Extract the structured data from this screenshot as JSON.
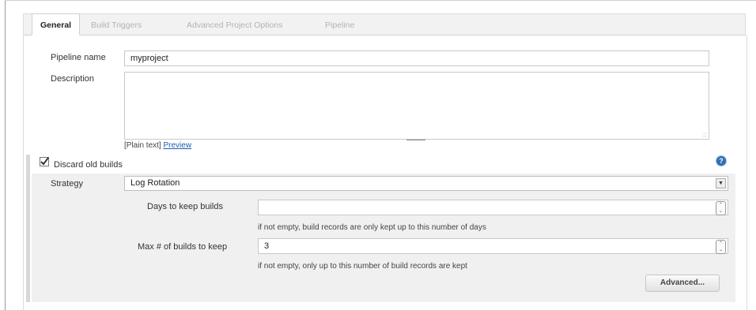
{
  "tabs": [
    {
      "label": "General",
      "active": true
    },
    {
      "label": "Build Triggers",
      "active": false
    },
    {
      "label": "Advanced Project Options",
      "active": false
    },
    {
      "label": "Pipeline",
      "active": false
    }
  ],
  "pipeline_name": {
    "label": "Pipeline name",
    "value": "myproject"
  },
  "description": {
    "label": "Description",
    "value": ""
  },
  "format_note": {
    "prefix": "[Plain text]",
    "preview_link": "Preview"
  },
  "discard_old_builds": {
    "label": "Discard old builds",
    "checked": true,
    "help_icon": "?"
  },
  "strategy": {
    "label": "Strategy",
    "selected": "Log Rotation"
  },
  "days_to_keep": {
    "label": "Days to keep builds",
    "value": "",
    "hint": "if not empty, build records are only kept up to this number of days"
  },
  "max_builds": {
    "label": "Max # of builds to keep",
    "value": "3",
    "hint": "if not empty, only up to this number of build records are kept"
  },
  "advanced_button": "Advanced...",
  "colors": {
    "link": "#1a5fb4",
    "help": "#2f6fb2"
  }
}
